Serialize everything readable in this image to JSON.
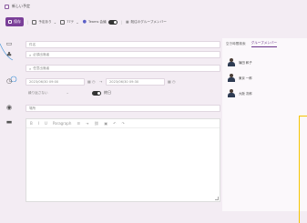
{
  "window": {
    "title": "新しい予定"
  },
  "toolbar": {
    "save_label": "保存",
    "event_type": "予定あり",
    "tz": "77テ",
    "teams_label": "Teams 会議",
    "group_label": "既往のグループメンバー"
  },
  "form": {
    "title_placeholder": "件名",
    "required_attendees_placeholder": "必須出席者",
    "optional_attendees_placeholder": "任意出席者",
    "start": "2023/06/30 09:00",
    "end": "2023/06/30 09:30",
    "repeat": "繰り返さない",
    "allday_label": "終日",
    "location_placeholder": "場所",
    "editor_format": "Paragraph"
  },
  "side": {
    "tabs": [
      {
        "label": "空き時間検索"
      },
      {
        "label": "グループメンバー"
      }
    ],
    "members": [
      {
        "name": "篠田 和子"
      },
      {
        "name": "東京 一郎"
      },
      {
        "name": "大阪 次郎"
      }
    ]
  }
}
